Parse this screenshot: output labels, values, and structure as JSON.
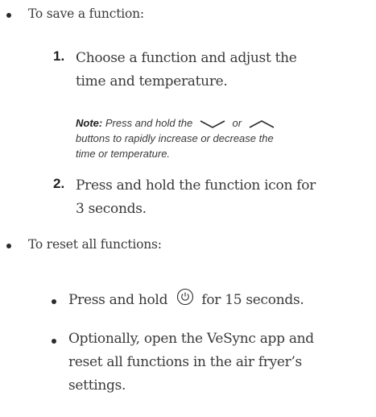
{
  "sections": [
    {
      "heading": "To save a function:",
      "steps": [
        {
          "number": "1.",
          "lines": [
            "Choose a function and adjust the",
            "time and temperature."
          ]
        },
        {
          "number": "2.",
          "lines": [
            "Press and hold the function icon for",
            "3 seconds."
          ]
        }
      ],
      "note": {
        "label": "Note:",
        "text_before": "Press and hold the",
        "icon_down": "chevron-down-icon",
        "or": "or",
        "icon_up": "chevron-up-icon",
        "lines_after": [
          "buttons to rapidly increase or decrease the",
          "time or temperature."
        ]
      }
    },
    {
      "heading": "To reset all functions:",
      "items": [
        {
          "text_before": "Press and hold",
          "icon": "power-icon",
          "text_after": "for 15 seconds."
        },
        {
          "lines": [
            "Optionally, open the VeSync app and",
            "reset all functions in the air fryer’s",
            "settings."
          ]
        }
      ]
    }
  ]
}
